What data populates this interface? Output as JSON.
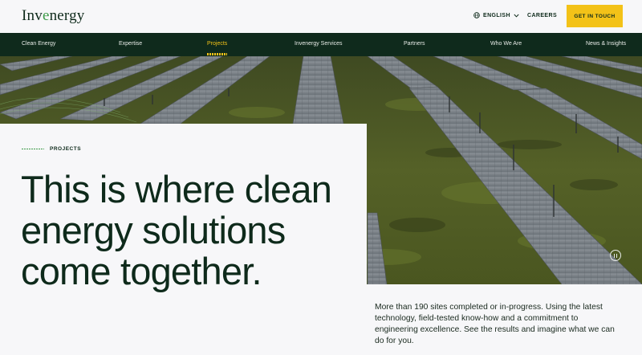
{
  "header": {
    "logo_text": "Invenergy",
    "language": "ENGLISH",
    "careers": "CAREERS",
    "cta": "GET IN TOUCH"
  },
  "nav": {
    "items": [
      {
        "label": "Clean Energy"
      },
      {
        "label": "Expertise"
      },
      {
        "label": "Projects",
        "active": true
      },
      {
        "label": "Invenergy Services"
      },
      {
        "label": "Partners"
      },
      {
        "label": "Who We Are"
      },
      {
        "label": "News & Insights"
      }
    ]
  },
  "hero": {
    "eyebrow": "PROJECTS",
    "headline_lines": [
      "This is where clean",
      "energy solutions",
      "come together."
    ],
    "intro": "More than 190 sites completed or in-progress. Using the latest technology, field-tested know-how and a commitment to engineering excellence. See the results and imagine what we can do for you.",
    "image_subject": "solar-panel-rows-in-green-field"
  },
  "colors": {
    "brand_dark": "#0f2a1c",
    "accent_yellow": "#f3c218",
    "brand_green": "#3c9a48",
    "background": "#f7f7f9"
  }
}
